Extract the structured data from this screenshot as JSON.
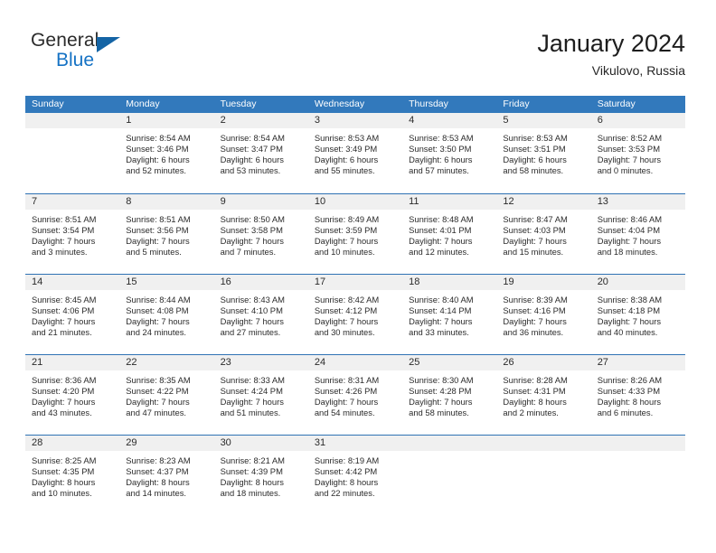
{
  "brand": {
    "name_top": "General",
    "name_bottom": "Blue"
  },
  "header": {
    "title": "January 2024",
    "subtitle": "Vikulovo, Russia"
  },
  "calendar": {
    "weekday_headers": [
      "Sunday",
      "Monday",
      "Tuesday",
      "Wednesday",
      "Thursday",
      "Friday",
      "Saturday"
    ],
    "accent_color": "#3279bc",
    "separator_color": "#2f72b4",
    "daynum_band_color": "#f0f0f0",
    "weeks": [
      [
        {
          "day": "",
          "sunrise": "",
          "sunset": "",
          "daylight_line1": "",
          "daylight_line2": ""
        },
        {
          "day": "1",
          "sunrise": "Sunrise: 8:54 AM",
          "sunset": "Sunset: 3:46 PM",
          "daylight_line1": "Daylight: 6 hours",
          "daylight_line2": "and 52 minutes."
        },
        {
          "day": "2",
          "sunrise": "Sunrise: 8:54 AM",
          "sunset": "Sunset: 3:47 PM",
          "daylight_line1": "Daylight: 6 hours",
          "daylight_line2": "and 53 minutes."
        },
        {
          "day": "3",
          "sunrise": "Sunrise: 8:53 AM",
          "sunset": "Sunset: 3:49 PM",
          "daylight_line1": "Daylight: 6 hours",
          "daylight_line2": "and 55 minutes."
        },
        {
          "day": "4",
          "sunrise": "Sunrise: 8:53 AM",
          "sunset": "Sunset: 3:50 PM",
          "daylight_line1": "Daylight: 6 hours",
          "daylight_line2": "and 57 minutes."
        },
        {
          "day": "5",
          "sunrise": "Sunrise: 8:53 AM",
          "sunset": "Sunset: 3:51 PM",
          "daylight_line1": "Daylight: 6 hours",
          "daylight_line2": "and 58 minutes."
        },
        {
          "day": "6",
          "sunrise": "Sunrise: 8:52 AM",
          "sunset": "Sunset: 3:53 PM",
          "daylight_line1": "Daylight: 7 hours",
          "daylight_line2": "and 0 minutes."
        }
      ],
      [
        {
          "day": "7",
          "sunrise": "Sunrise: 8:51 AM",
          "sunset": "Sunset: 3:54 PM",
          "daylight_line1": "Daylight: 7 hours",
          "daylight_line2": "and 3 minutes."
        },
        {
          "day": "8",
          "sunrise": "Sunrise: 8:51 AM",
          "sunset": "Sunset: 3:56 PM",
          "daylight_line1": "Daylight: 7 hours",
          "daylight_line2": "and 5 minutes."
        },
        {
          "day": "9",
          "sunrise": "Sunrise: 8:50 AM",
          "sunset": "Sunset: 3:58 PM",
          "daylight_line1": "Daylight: 7 hours",
          "daylight_line2": "and 7 minutes."
        },
        {
          "day": "10",
          "sunrise": "Sunrise: 8:49 AM",
          "sunset": "Sunset: 3:59 PM",
          "daylight_line1": "Daylight: 7 hours",
          "daylight_line2": "and 10 minutes."
        },
        {
          "day": "11",
          "sunrise": "Sunrise: 8:48 AM",
          "sunset": "Sunset: 4:01 PM",
          "daylight_line1": "Daylight: 7 hours",
          "daylight_line2": "and 12 minutes."
        },
        {
          "day": "12",
          "sunrise": "Sunrise: 8:47 AM",
          "sunset": "Sunset: 4:03 PM",
          "daylight_line1": "Daylight: 7 hours",
          "daylight_line2": "and 15 minutes."
        },
        {
          "day": "13",
          "sunrise": "Sunrise: 8:46 AM",
          "sunset": "Sunset: 4:04 PM",
          "daylight_line1": "Daylight: 7 hours",
          "daylight_line2": "and 18 minutes."
        }
      ],
      [
        {
          "day": "14",
          "sunrise": "Sunrise: 8:45 AM",
          "sunset": "Sunset: 4:06 PM",
          "daylight_line1": "Daylight: 7 hours",
          "daylight_line2": "and 21 minutes."
        },
        {
          "day": "15",
          "sunrise": "Sunrise: 8:44 AM",
          "sunset": "Sunset: 4:08 PM",
          "daylight_line1": "Daylight: 7 hours",
          "daylight_line2": "and 24 minutes."
        },
        {
          "day": "16",
          "sunrise": "Sunrise: 8:43 AM",
          "sunset": "Sunset: 4:10 PM",
          "daylight_line1": "Daylight: 7 hours",
          "daylight_line2": "and 27 minutes."
        },
        {
          "day": "17",
          "sunrise": "Sunrise: 8:42 AM",
          "sunset": "Sunset: 4:12 PM",
          "daylight_line1": "Daylight: 7 hours",
          "daylight_line2": "and 30 minutes."
        },
        {
          "day": "18",
          "sunrise": "Sunrise: 8:40 AM",
          "sunset": "Sunset: 4:14 PM",
          "daylight_line1": "Daylight: 7 hours",
          "daylight_line2": "and 33 minutes."
        },
        {
          "day": "19",
          "sunrise": "Sunrise: 8:39 AM",
          "sunset": "Sunset: 4:16 PM",
          "daylight_line1": "Daylight: 7 hours",
          "daylight_line2": "and 36 minutes."
        },
        {
          "day": "20",
          "sunrise": "Sunrise: 8:38 AM",
          "sunset": "Sunset: 4:18 PM",
          "daylight_line1": "Daylight: 7 hours",
          "daylight_line2": "and 40 minutes."
        }
      ],
      [
        {
          "day": "21",
          "sunrise": "Sunrise: 8:36 AM",
          "sunset": "Sunset: 4:20 PM",
          "daylight_line1": "Daylight: 7 hours",
          "daylight_line2": "and 43 minutes."
        },
        {
          "day": "22",
          "sunrise": "Sunrise: 8:35 AM",
          "sunset": "Sunset: 4:22 PM",
          "daylight_line1": "Daylight: 7 hours",
          "daylight_line2": "and 47 minutes."
        },
        {
          "day": "23",
          "sunrise": "Sunrise: 8:33 AM",
          "sunset": "Sunset: 4:24 PM",
          "daylight_line1": "Daylight: 7 hours",
          "daylight_line2": "and 51 minutes."
        },
        {
          "day": "24",
          "sunrise": "Sunrise: 8:31 AM",
          "sunset": "Sunset: 4:26 PM",
          "daylight_line1": "Daylight: 7 hours",
          "daylight_line2": "and 54 minutes."
        },
        {
          "day": "25",
          "sunrise": "Sunrise: 8:30 AM",
          "sunset": "Sunset: 4:28 PM",
          "daylight_line1": "Daylight: 7 hours",
          "daylight_line2": "and 58 minutes."
        },
        {
          "day": "26",
          "sunrise": "Sunrise: 8:28 AM",
          "sunset": "Sunset: 4:31 PM",
          "daylight_line1": "Daylight: 8 hours",
          "daylight_line2": "and 2 minutes."
        },
        {
          "day": "27",
          "sunrise": "Sunrise: 8:26 AM",
          "sunset": "Sunset: 4:33 PM",
          "daylight_line1": "Daylight: 8 hours",
          "daylight_line2": "and 6 minutes."
        }
      ],
      [
        {
          "day": "28",
          "sunrise": "Sunrise: 8:25 AM",
          "sunset": "Sunset: 4:35 PM",
          "daylight_line1": "Daylight: 8 hours",
          "daylight_line2": "and 10 minutes."
        },
        {
          "day": "29",
          "sunrise": "Sunrise: 8:23 AM",
          "sunset": "Sunset: 4:37 PM",
          "daylight_line1": "Daylight: 8 hours",
          "daylight_line2": "and 14 minutes."
        },
        {
          "day": "30",
          "sunrise": "Sunrise: 8:21 AM",
          "sunset": "Sunset: 4:39 PM",
          "daylight_line1": "Daylight: 8 hours",
          "daylight_line2": "and 18 minutes."
        },
        {
          "day": "31",
          "sunrise": "Sunrise: 8:19 AM",
          "sunset": "Sunset: 4:42 PM",
          "daylight_line1": "Daylight: 8 hours",
          "daylight_line2": "and 22 minutes."
        },
        {
          "day": "",
          "sunrise": "",
          "sunset": "",
          "daylight_line1": "",
          "daylight_line2": ""
        },
        {
          "day": "",
          "sunrise": "",
          "sunset": "",
          "daylight_line1": "",
          "daylight_line2": ""
        },
        {
          "day": "",
          "sunrise": "",
          "sunset": "",
          "daylight_line1": "",
          "daylight_line2": ""
        }
      ]
    ]
  }
}
